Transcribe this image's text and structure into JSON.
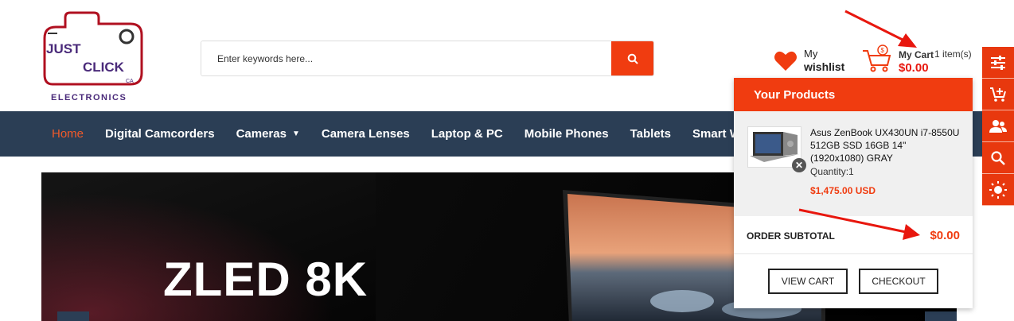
{
  "logo": {
    "line1": "JUST",
    "line2": "CLICK",
    "suffix": "CA",
    "line3": "ELECTRONICS"
  },
  "search": {
    "placeholder": "Enter keywords here..."
  },
  "wishlist": {
    "line1": "My",
    "line2": "wishlist"
  },
  "cart": {
    "label": "My Cart",
    "count": "1 item(s)",
    "total": "$0.00"
  },
  "nav": {
    "items": [
      {
        "label": "Home",
        "active": true
      },
      {
        "label": "Digital Camcorders"
      },
      {
        "label": "Cameras",
        "has_caret": true
      },
      {
        "label": "Camera Lenses"
      },
      {
        "label": "Laptop & PC"
      },
      {
        "label": "Mobile Phones"
      },
      {
        "label": "Tablets"
      },
      {
        "label": "Smart Watch"
      }
    ]
  },
  "banner": {
    "headline": "ZLED 8K"
  },
  "sidebar": {
    "icons": [
      "sliders-icon",
      "cart-add-icon",
      "users-icon",
      "search-icon",
      "brightness-icon"
    ]
  },
  "dropdown": {
    "title": "Your Products",
    "product": {
      "name": "Asus ZenBook UX430UN i7-8550U 512GB SSD 16GB 14\" (1920x1080) GRAY",
      "quantity": "Quantity:1",
      "price": "$1,475.00 USD",
      "remove_label": "✕"
    },
    "subtotal_label": "ORDER SUBTOTAL",
    "subtotal_value": "$0.00",
    "view_cart": "VIEW CART",
    "checkout": "CHECKOUT"
  },
  "colors": {
    "accent": "#f03c10",
    "nav_bg": "#2b3e55",
    "price_red": "#e8170e",
    "annotation": "#e8170e"
  }
}
